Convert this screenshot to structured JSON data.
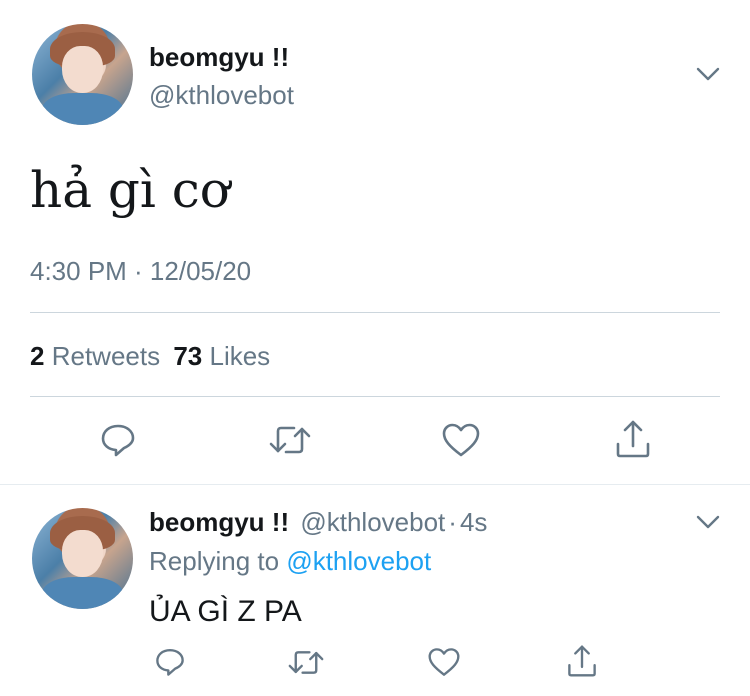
{
  "main_tweet": {
    "display_name": "beomgyu !!",
    "handle": "@kthlovebot",
    "text": "hả gì cơ",
    "timestamp": "4:30 PM · 12/05/20",
    "stats": {
      "retweets_count": "2",
      "retweets_label": "Retweets",
      "likes_count": "73",
      "likes_label": "Likes"
    },
    "actions": [
      "reply-icon",
      "retweet-icon",
      "like-icon",
      "share-icon"
    ]
  },
  "reply_tweet": {
    "display_name": "beomgyu !!",
    "handle": "@kthlovebot",
    "time_ago": "4s",
    "separator": "·",
    "replying_prefix": "Replying to",
    "replying_handle": "@kthlovebot",
    "text": "ỦA GÌ Z PA",
    "actions": [
      "reply-icon",
      "retweet-icon",
      "like-icon",
      "share-icon"
    ]
  },
  "colors": {
    "text": "#14171a",
    "muted": "#657786",
    "link": "#1da1f2",
    "divider": "#ccd6dd"
  }
}
